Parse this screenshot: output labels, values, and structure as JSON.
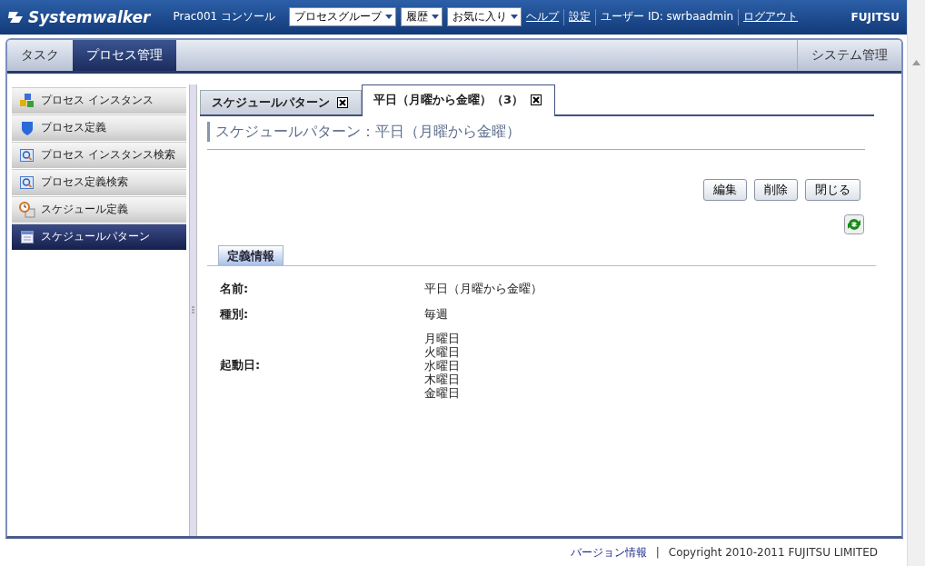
{
  "header": {
    "logo": "Systemwalker",
    "console": "Prac001 コンソール",
    "menus": [
      {
        "label": "プロセスグループ"
      },
      {
        "label": "履歴"
      },
      {
        "label": "お気に入り"
      }
    ],
    "links": [
      "ヘルプ",
      "設定"
    ],
    "user": "ユーザー ID: swrbaadmin",
    "logout": "ログアウト",
    "brand": "FUJITSU"
  },
  "main_tabs": [
    {
      "label": "タスク",
      "selected": false
    },
    {
      "label": "プロセス管理",
      "selected": true
    },
    {
      "label": "システム管理",
      "selected": false
    }
  ],
  "sidebar": {
    "items": [
      {
        "label": "プロセス インスタンス",
        "kind": "cubes",
        "selected": false
      },
      {
        "label": "プロセス定義",
        "kind": "shield",
        "selected": false
      },
      {
        "label": "プロセス インスタンス検索",
        "kind": "search",
        "selected": false
      },
      {
        "label": "プロセス定義検索",
        "kind": "search",
        "selected": false
      },
      {
        "label": "スケジュール定義",
        "kind": "clock",
        "selected": false
      },
      {
        "label": "スケジュールパターン",
        "kind": "calendar",
        "selected": true
      }
    ]
  },
  "content_tabs": [
    {
      "label": "スケジュールパターン",
      "selected": false
    },
    {
      "label": "平日（月曜から金曜）（3）",
      "selected": true
    }
  ],
  "heading": "スケジュールパターン：平日（月曜から金曜）",
  "buttons": [
    "編集",
    "削除",
    "閉じる"
  ],
  "section_tab": "定義情報",
  "fields": [
    {
      "label": "名前:",
      "values": [
        "平日（月曜から金曜）"
      ]
    },
    {
      "label": "種別:",
      "values": [
        "毎週"
      ]
    },
    {
      "label": "起動日:",
      "values": [
        "月曜日",
        "火曜日",
        "水曜日",
        "木曜日",
        "金曜日"
      ]
    }
  ],
  "footer": {
    "link": "バージョン情報",
    "separator": "|",
    "copyright": "Copyright 2010-2011 FUJITSU LIMITED"
  }
}
